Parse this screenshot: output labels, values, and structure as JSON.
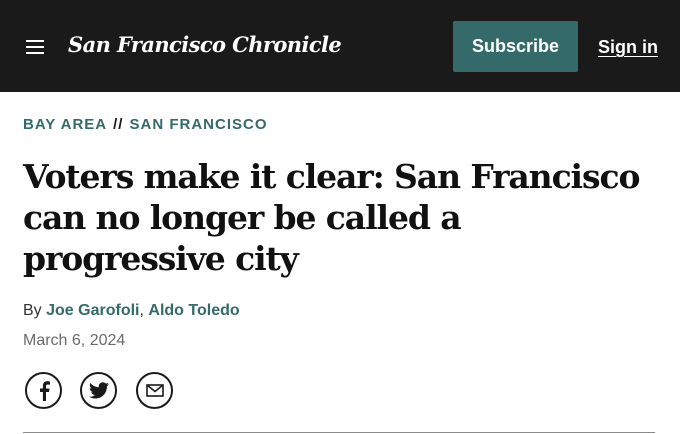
{
  "header": {
    "menu_icon": "hamburger-menu-icon",
    "logo_text": "San Francisco Chronicle",
    "subscribe_label": "Subscribe",
    "signin_label": "Sign in"
  },
  "breadcrumb": {
    "section": "BAY AREA",
    "separator": "//",
    "subsection": "SAN FRANCISCO"
  },
  "article": {
    "headline": "Voters make it clear: San Francisco can no longer be called a progressive city",
    "byline_prefix": "By",
    "authors": [
      "Joe Garofoli",
      "Aldo Toledo"
    ],
    "author_separator": ",",
    "date": "March 6, 2024"
  },
  "share": {
    "icons": [
      "facebook-icon",
      "twitter-icon",
      "email-icon"
    ]
  },
  "colors": {
    "topbar_bg": "#1a1a1a",
    "accent": "#346b6a",
    "text": "#111111",
    "muted": "#6b6b6b"
  }
}
